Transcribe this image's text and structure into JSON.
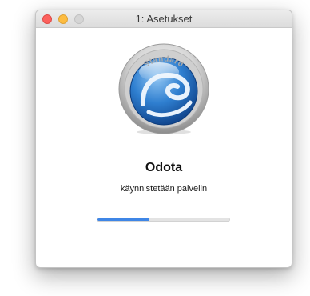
{
  "window": {
    "title": "1: Asetukset"
  },
  "logo": {
    "badge_text": "Standard",
    "icon": "globe-badge-icon"
  },
  "content": {
    "heading": "Odota",
    "message": "käynnistetään palvelin"
  },
  "progress": {
    "fraction": 0.39,
    "fill_color": "#3f86e6"
  },
  "colors": {
    "close": "#fc605c",
    "minimize": "#fdbc40",
    "zoom_disabled": "#d5d5d5"
  }
}
